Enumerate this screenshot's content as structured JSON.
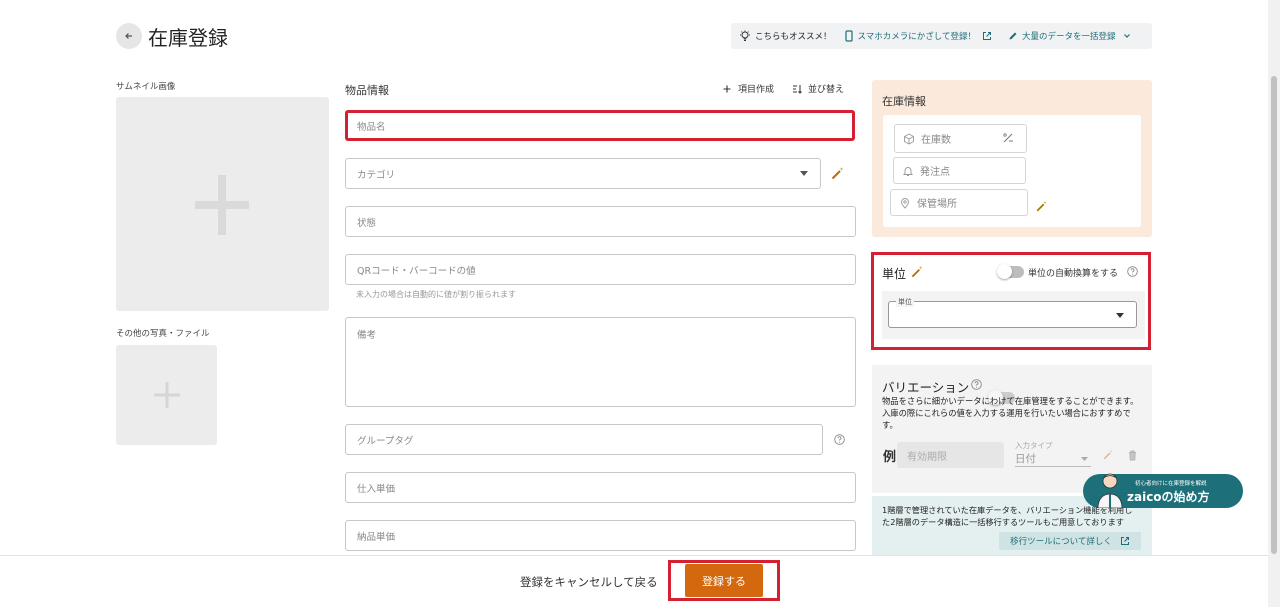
{
  "header": {
    "title": "在庫登録",
    "recommend": "こちらもオススメ！",
    "camera_link": "スマホカメラにかざして登録！",
    "bulk_link": "大量のデータを一括登録"
  },
  "thumbnail": {
    "label": "サムネイル画像"
  },
  "other_files": {
    "label": "その他の写真・ファイル"
  },
  "item_info": {
    "title": "物品情報",
    "create_field": "項目作成",
    "sort": "並び替え",
    "fields": {
      "name": "物品名",
      "category": "カテゴリ",
      "status": "状態",
      "qrcode": "QRコード・バーコードの値",
      "qrcode_help": "未入力の場合は自動的に値が割り振られます",
      "notes": "備考",
      "group_tag": "グループタグ",
      "purchase_price": "仕入単価",
      "sale_price": "納品単価"
    }
  },
  "stock_info": {
    "title": "在庫情報",
    "quantity": "在庫数",
    "reorder_point": "発注点",
    "location": "保管場所"
  },
  "unit": {
    "title": "単位",
    "auto_convert": "単位の自動換算をする",
    "field_label": "単位"
  },
  "variation": {
    "title": "バリエーション",
    "description": [
      "物品をさらに細かいデータにわけて在庫管理をすることができます。",
      "入庫の際にこれらの値を入力する運用を行いたい場合におすすめで",
      "す。"
    ],
    "example_label": "例",
    "example_field": "有効期限",
    "input_type_label": "入力タイプ",
    "input_type_value": "日付"
  },
  "migration": {
    "text_line1": "1階層で管理されていた在庫データを、バリエーション機能を利用し",
    "text_line2": "た2階層のデータ構造に一括移行するツールもご用意しております",
    "link": "移行ツールについて詳しく"
  },
  "badge": {
    "small": "初心者向けに在庫登録を解説",
    "main": "zaicoの始め方"
  },
  "footer": {
    "cancel": "登録をキャンセルして戻る",
    "submit": "登録する"
  },
  "colors": {
    "accent_orange": "#d4680e",
    "teal": "#1f6f78",
    "highlight_red": "#d32132",
    "stock_panel_bg": "#fbeadc"
  }
}
